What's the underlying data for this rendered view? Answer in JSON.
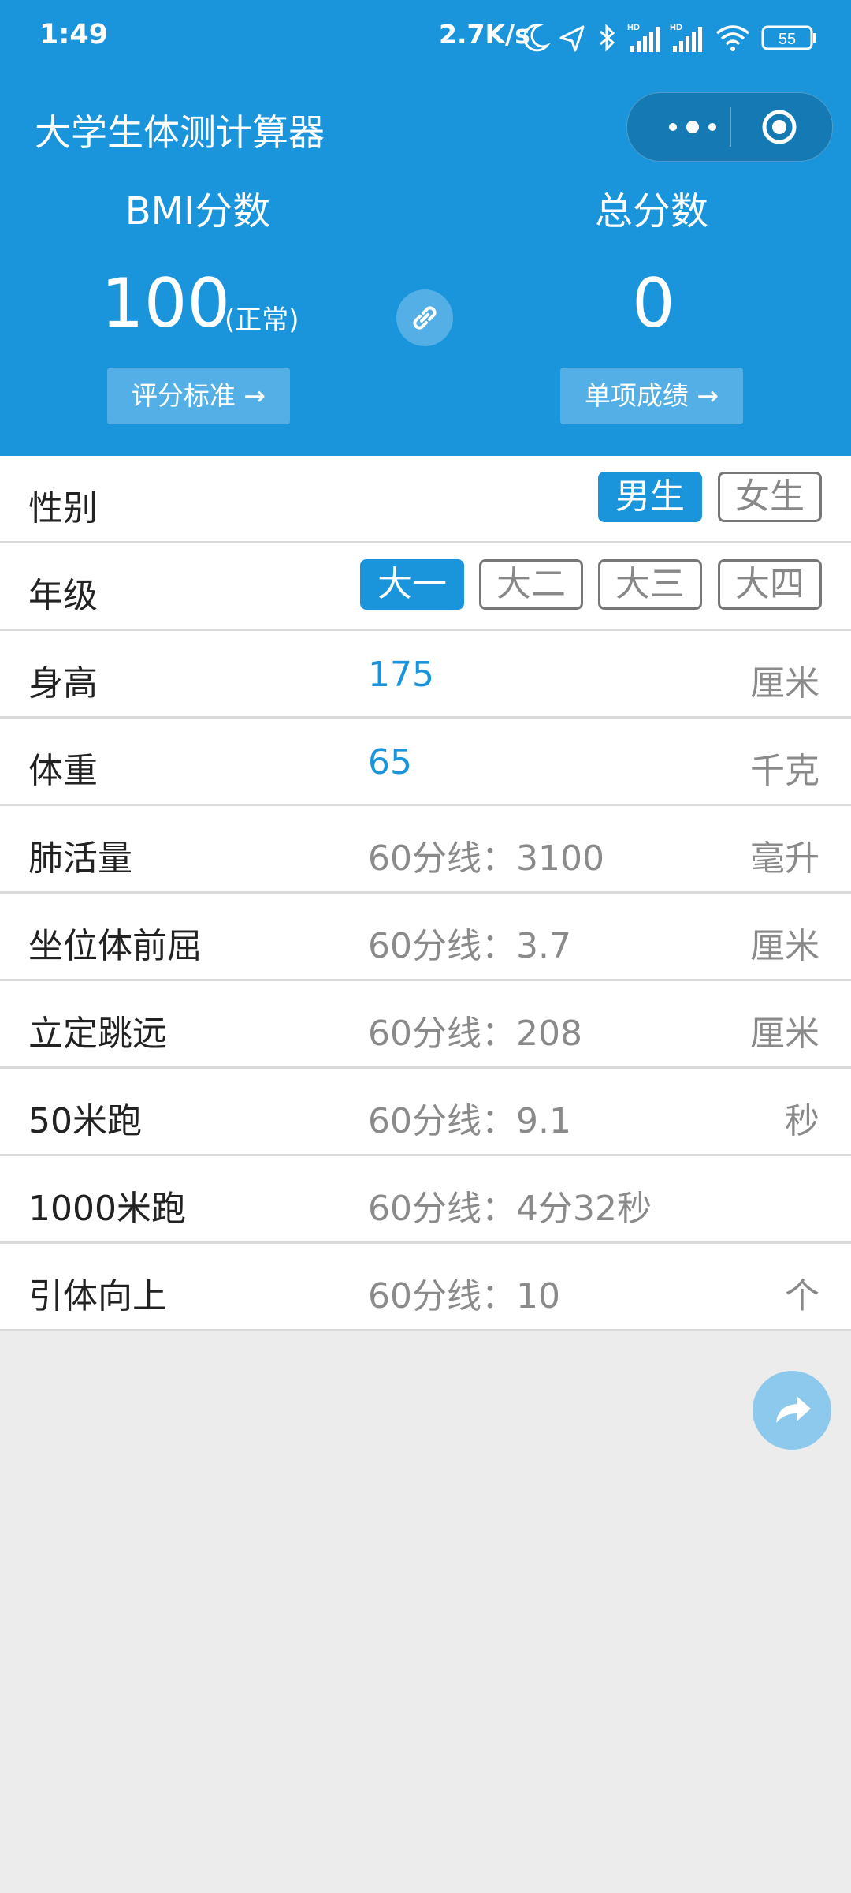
{
  "status_bar": {
    "time": "1:49",
    "speed": "2.7K/s",
    "battery": "55"
  },
  "header": {
    "title": "大学生体测计算器",
    "bmi": {
      "label": "BMI分数",
      "value": "100",
      "tag": "(正常)",
      "button": "评分标准"
    },
    "total": {
      "label": "总分数",
      "value": "0",
      "button": "单项成绩"
    }
  },
  "form": {
    "gender": {
      "label": "性别",
      "options": [
        "男生",
        "女生"
      ],
      "selected": "男生"
    },
    "grade": {
      "label": "年级",
      "options": [
        "大一",
        "大二",
        "大三",
        "大四"
      ],
      "selected": "大一"
    },
    "height": {
      "label": "身高",
      "value": "175",
      "unit": "厘米"
    },
    "weight": {
      "label": "体重",
      "value": "65",
      "unit": "千克"
    },
    "vital": {
      "label": "肺活量",
      "placeholder": "60分线：3100",
      "unit": "毫升"
    },
    "sit_reach": {
      "label": "坐位体前屈",
      "placeholder": "60分线：3.7",
      "unit": "厘米"
    },
    "long_jump": {
      "label": "立定跳远",
      "placeholder": "60分线：208",
      "unit": "厘米"
    },
    "run50": {
      "label": "50米跑",
      "placeholder": "60分线：9.1",
      "unit": "秒"
    },
    "run1000": {
      "label": "1000米跑",
      "placeholder": "60分线：4分32秒",
      "unit": ""
    },
    "pullup": {
      "label": "引体向上",
      "placeholder": "60分线：10",
      "unit": "个"
    }
  },
  "colors": {
    "primary": "#1a95dc",
    "share_button": "#8cc9ec"
  },
  "icons": [
    "moon-icon",
    "location-icon",
    "bluetooth-icon",
    "signal-icon",
    "wifi-icon",
    "battery-icon",
    "more-dots-icon",
    "target-icon",
    "link-icon",
    "arrow-right-icon",
    "share-icon"
  ]
}
